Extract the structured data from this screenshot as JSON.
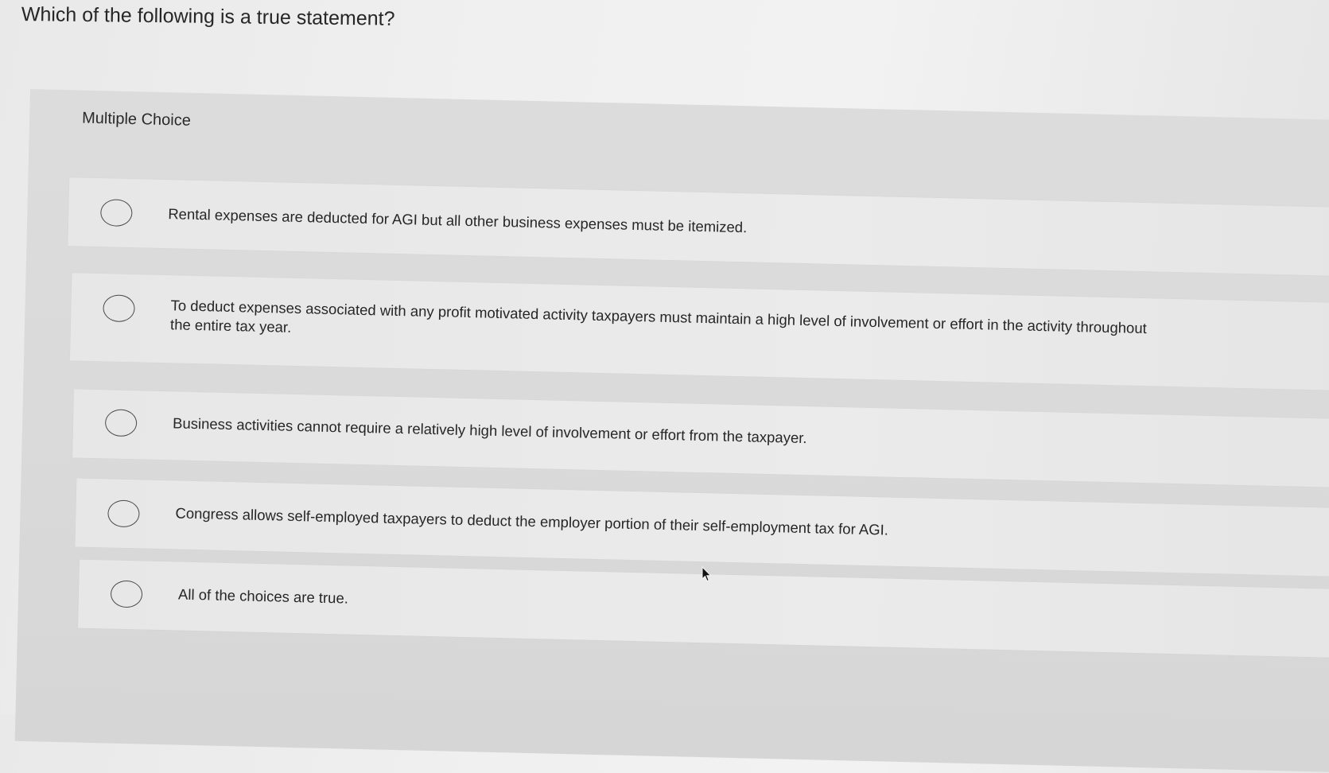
{
  "question": "Which of the following is a true statement?",
  "section_label": "Multiple Choice",
  "choices": [
    {
      "label": "Rental expenses are deducted for AGI but all other business expenses must be itemized.",
      "selected": false
    },
    {
      "label": "To deduct expenses associated with any profit motivated activity taxpayers must maintain a high level of involvement or effort in the activity throughout the entire tax year.",
      "selected": false
    },
    {
      "label": "Business activities cannot require a relatively high level of involvement or effort from the taxpayer.",
      "selected": false
    },
    {
      "label": "Congress allows self-employed taxpayers to deduct the employer portion of their self-employment tax for AGI.",
      "selected": false
    },
    {
      "label": "All of the choices are true.",
      "selected": false
    }
  ],
  "icons": {
    "radio": "radio-unselected-icon",
    "cursor": "mouse-pointer-icon"
  }
}
